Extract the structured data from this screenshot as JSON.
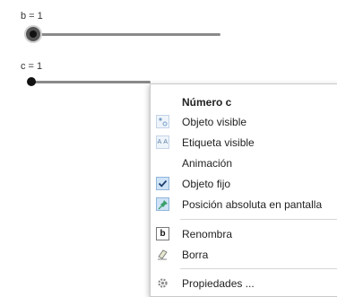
{
  "sliders": [
    {
      "label": "b = 1"
    },
    {
      "label": "c = 1"
    }
  ],
  "context_menu": {
    "title": "Número c",
    "items": [
      {
        "label": "Objeto visible",
        "icon": "show-object-icon"
      },
      {
        "label": "Etiqueta visible",
        "icon": "label-icon"
      },
      {
        "label": "Animación",
        "icon": "none"
      },
      {
        "label": "Objeto fijo",
        "icon": "checkmark-icon",
        "checked": true
      },
      {
        "label": "Posición absoluta en pantalla",
        "icon": "pin-icon",
        "checked": true
      },
      {
        "label": "Renombra",
        "icon": "rename-icon"
      },
      {
        "label": "Borra",
        "icon": "eraser-icon"
      },
      {
        "label": "Propiedades ...",
        "icon": "gear-icon"
      }
    ]
  },
  "colors": {
    "checked_bg": "#cfe3f7",
    "slider_track": "#8a8a8a",
    "knob": "#111111"
  }
}
